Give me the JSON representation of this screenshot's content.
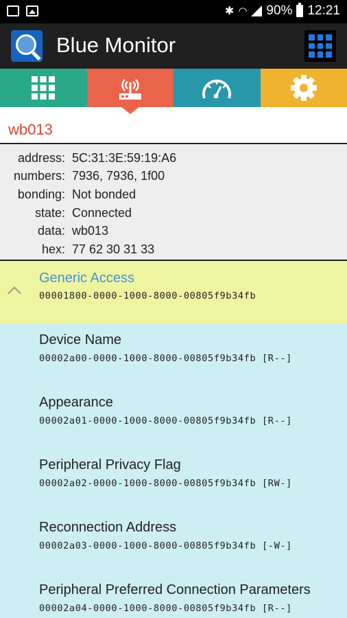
{
  "status_bar": {
    "battery": "90%",
    "time": "12:21",
    "icons": [
      "gallery-icon",
      "image-icon",
      "bluetooth-icon",
      "wifi-icon",
      "signal-icon",
      "battery-icon"
    ]
  },
  "app": {
    "title": "Blue Monitor"
  },
  "tabs": [
    {
      "name": "tab-grid",
      "icon": "grid-icon",
      "color": "#2aa88a",
      "active": false
    },
    {
      "name": "tab-device",
      "icon": "router-signal-icon",
      "color": "#e9644a",
      "active": true
    },
    {
      "name": "tab-meter",
      "icon": "speedometer-icon",
      "color": "#2797a9",
      "active": false
    },
    {
      "name": "tab-settings",
      "icon": "gear-icon",
      "color": "#f0b32f",
      "active": false
    }
  ],
  "device": {
    "name": "wb013",
    "info": [
      {
        "label": "address:",
        "value": "5C:31:3E:59:19:A6"
      },
      {
        "label": "numbers:",
        "value": "7936, 7936, 1f00"
      },
      {
        "label": "bonding:",
        "value": "Not bonded"
      },
      {
        "label": "state:",
        "value": "Connected"
      },
      {
        "label": "data:",
        "value": "wb013"
      },
      {
        "label": "hex:",
        "value": "77 62 30 31 33"
      }
    ]
  },
  "service": {
    "name": "Generic Access",
    "uuid": "00001800-0000-1000-8000-00805f9b34fb"
  },
  "characteristics": [
    {
      "name": "Device Name",
      "uuid": "00002a00-0000-1000-8000-00805f9b34fb [R--]"
    },
    {
      "name": "Appearance",
      "uuid": "00002a01-0000-1000-8000-00805f9b34fb [R--]"
    },
    {
      "name": "Peripheral Privacy Flag",
      "uuid": "00002a02-0000-1000-8000-00805f9b34fb [RW-]"
    },
    {
      "name": "Reconnection Address",
      "uuid": "00002a03-0000-1000-8000-00805f9b34fb [-W-]"
    },
    {
      "name": "Peripheral Preferred Connection Parameters",
      "uuid": "00002a04-0000-1000-8000-00805f9b34fb [R--]"
    }
  ],
  "colors": {
    "accent": "#e0452b",
    "service_header": "#eef5a0",
    "service_name": "#4a8fe0",
    "list_background": "#cdeef2"
  }
}
